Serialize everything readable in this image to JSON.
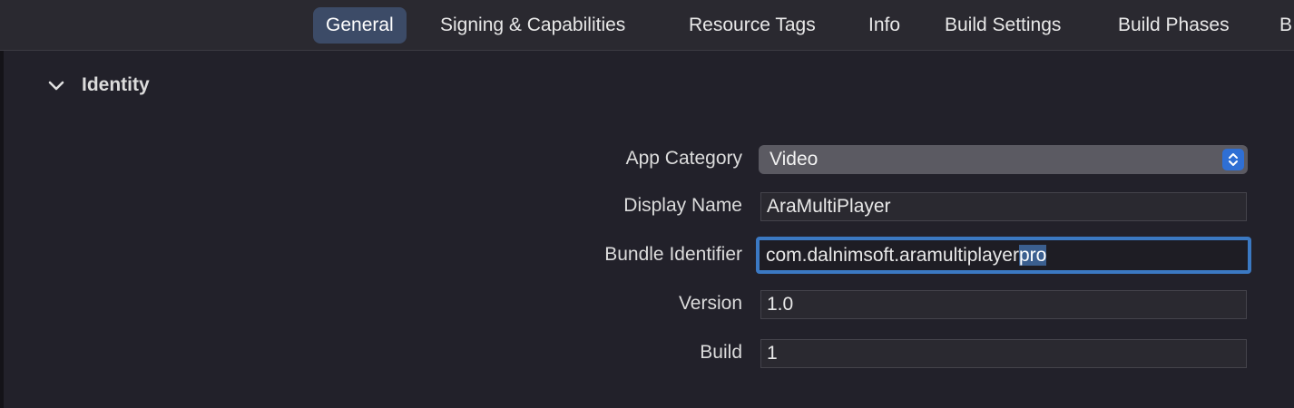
{
  "tabs": [
    {
      "label": "General",
      "active": true
    },
    {
      "label": "Signing & Capabilities"
    },
    {
      "label": "Resource Tags"
    },
    {
      "label": "Info"
    },
    {
      "label": "Build Settings"
    },
    {
      "label": "Build Phases"
    },
    {
      "label": "B"
    }
  ],
  "identity": {
    "title": "Identity",
    "app_category": {
      "label": "App Category",
      "value": "Video"
    },
    "display_name": {
      "label": "Display Name",
      "value": "AraMultiPlayer"
    },
    "bundle_identifier": {
      "label": "Bundle Identifier",
      "value_unselected": "com.dalnimsoft.aramultiplayer",
      "value_selected": "pro"
    },
    "version": {
      "label": "Version",
      "value": "1.0"
    },
    "build": {
      "label": "Build",
      "value": "1"
    }
  },
  "colors": {
    "accent": "#3b79c3",
    "active_tab": "#3c4b67",
    "background": "#22212a"
  },
  "icons": [
    "chevron-down-icon",
    "popup-stepper-icon"
  ]
}
